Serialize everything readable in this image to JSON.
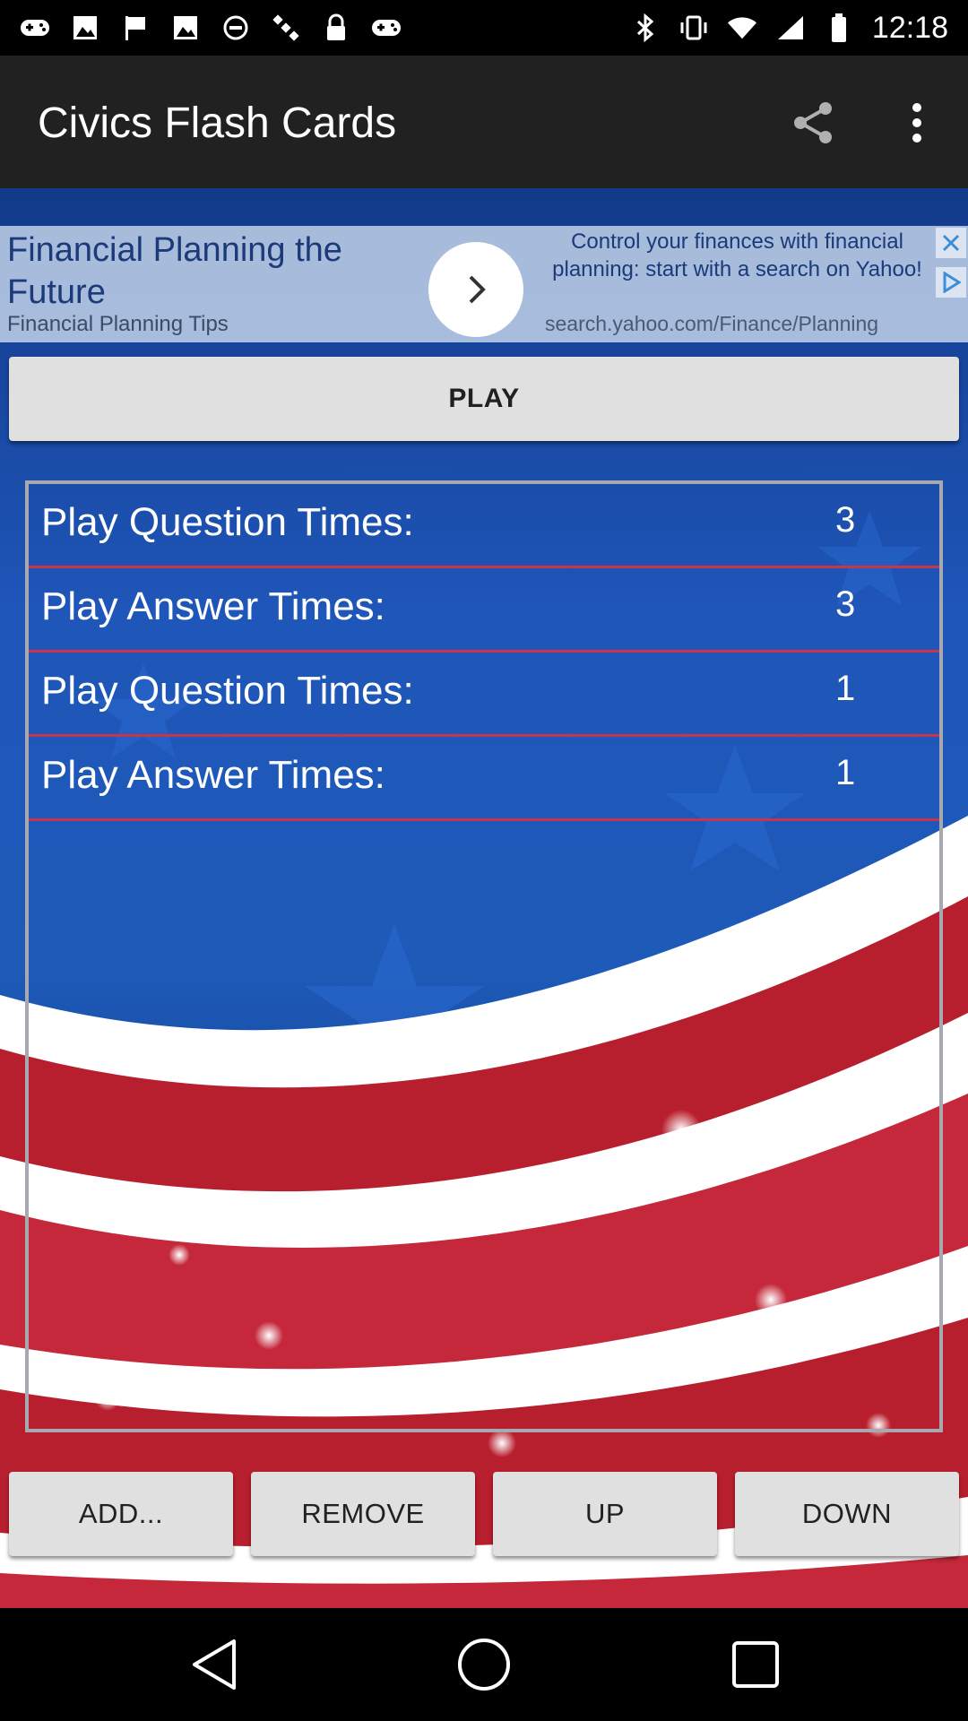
{
  "status_bar": {
    "time": "12:18",
    "left_icons": [
      "gamepad-icon",
      "image-icon",
      "flag-icon",
      "image-icon",
      "do-not-disturb-icon",
      "satellite-icon",
      "lock-icon",
      "gamepad-icon"
    ],
    "right_icons": [
      "bluetooth-icon",
      "vibrate-icon",
      "wifi-icon",
      "signal-icon",
      "battery-icon"
    ]
  },
  "app_bar": {
    "title": "Civics Flash Cards",
    "share_icon": "share-icon",
    "menu_icon": "more-vert-icon"
  },
  "ad": {
    "headline": "Financial Planning the Future",
    "subline": "Financial Planning Tips",
    "description": "Control your finances with financial planning: start with a search on Yahoo!",
    "url": "search.yahoo.com/Finance/Planning"
  },
  "play_button": {
    "label": "PLAY"
  },
  "list": {
    "rows": [
      {
        "label": "Play Question Times:",
        "value": "3"
      },
      {
        "label": "Play Answer Times:",
        "value": "3"
      },
      {
        "label": "Play Question Times:",
        "value": "1"
      },
      {
        "label": "Play Answer Times:",
        "value": "1"
      }
    ]
  },
  "bottom_buttons": {
    "add": "ADD...",
    "remove": "REMOVE",
    "up": "UP",
    "down": "DOWN"
  },
  "nav_bar": {
    "icons": [
      "back-icon",
      "home-icon",
      "recents-icon"
    ]
  },
  "colors": {
    "app_bar": "#212121",
    "row_divider": "#c8354a",
    "button_bg": "#e0e0e0",
    "background_blue": "#1f56b9"
  }
}
